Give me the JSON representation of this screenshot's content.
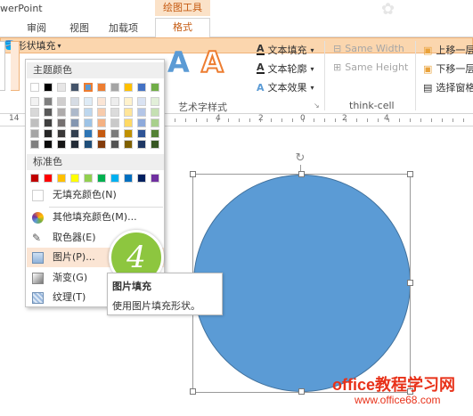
{
  "app": {
    "title": "werPoint",
    "tool_group": "绘图工具"
  },
  "tabs": [
    {
      "label": "审阅"
    },
    {
      "label": "视图"
    },
    {
      "label": "加载项"
    },
    {
      "label": "格式"
    }
  ],
  "ribbon": {
    "shape_fill": "形状填充",
    "text_fill": "文本填充",
    "text_outline": "文本轮廓",
    "text_effects": "文本效果",
    "art_group": "艺术字样式",
    "same_width": "Same Width",
    "same_height": "Same Height",
    "thinkcell_group": "think-cell",
    "bring_forward": "上移一层",
    "send_backward": "下移一层",
    "selection_pane": "选择窗格"
  },
  "ruler": {
    "left_number": "14",
    "numbers": [
      "4",
      "2",
      "0",
      "2",
      "4"
    ]
  },
  "dropdown": {
    "theme_colors_header": "主题颜色",
    "standard_colors_header": "标准色",
    "no_fill": "无填充颜色(N)",
    "more_colors": "其他填充颜色(M)...",
    "eyedropper": "取色器(E)",
    "picture": "图片(P)...",
    "gradient": "渐变(G)",
    "texture": "纹理(T)"
  },
  "theme_colors": {
    "top": [
      "#ffffff",
      "#000000",
      "#e7e6e6",
      "#44546a",
      "#5b9bd5",
      "#ed7d31",
      "#a5a5a5",
      "#ffc000",
      "#4472c4",
      "#70ad47"
    ],
    "shades": [
      [
        "#f2f2f2",
        "#7f7f7f",
        "#d0cece",
        "#d6dce4",
        "#deebf6",
        "#fbe5d5",
        "#ededed",
        "#fff2cc",
        "#dae3f3",
        "#e2efd9"
      ],
      [
        "#d8d8d8",
        "#595959",
        "#aeabab",
        "#adb9ca",
        "#bdd7ee",
        "#f7cbac",
        "#dbdbdb",
        "#ffe599",
        "#b4c6e7",
        "#c5e0b3"
      ],
      [
        "#bfbfbf",
        "#3f3f3f",
        "#757070",
        "#8496b0",
        "#9dc3e6",
        "#f4b183",
        "#c9c9c9",
        "#ffd965",
        "#8eaadb",
        "#a8d08d"
      ],
      [
        "#a5a5a5",
        "#262626",
        "#3a3838",
        "#323f4f",
        "#2e75b5",
        "#c55a11",
        "#7b7b7b",
        "#bf9000",
        "#2f5496",
        "#538135"
      ],
      [
        "#7f7f7f",
        "#0c0c0c",
        "#171616",
        "#222a35",
        "#1f4e79",
        "#833c0b",
        "#525252",
        "#7f6000",
        "#1f3864",
        "#375623"
      ]
    ],
    "standard": [
      "#c00000",
      "#ff0000",
      "#ffc000",
      "#ffff00",
      "#92d050",
      "#00b050",
      "#00b0f0",
      "#0070c0",
      "#002060",
      "#7030a0"
    ]
  },
  "step_number": "4",
  "tooltip": {
    "title": "图片填充",
    "description": "使用图片填充形状。"
  },
  "shape_color": "#5b9bd5",
  "watermark": {
    "line1": "office教程学习网",
    "line2": "www.office68.com"
  }
}
